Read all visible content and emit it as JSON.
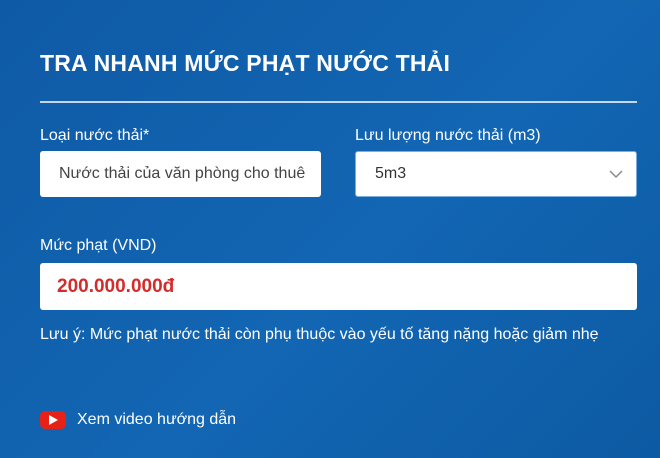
{
  "header": {
    "title": "TRA NHANH MỨC PHẠT NƯỚC THẢI"
  },
  "form": {
    "wastewater_type": {
      "label": "Loại nước thải*",
      "value": "Nước thải của văn phòng cho thuê"
    },
    "flow_rate": {
      "label": "Lưu lượng nước thải (m3)",
      "value": "5m3"
    },
    "fine": {
      "label": "Mức phạt (VND)",
      "value": "200.000.000đ"
    }
  },
  "note": "Lưu ý: Mức phạt nước thải còn phụ thuộc vào yếu tố tăng nặng hoặc giảm nhẹ",
  "video_link": {
    "label": "Xem video hướng dẫn",
    "icon": "youtube-icon"
  },
  "colors": {
    "background": "#1266b3",
    "fine_value": "#d42b2b",
    "youtube": "#e62117"
  }
}
